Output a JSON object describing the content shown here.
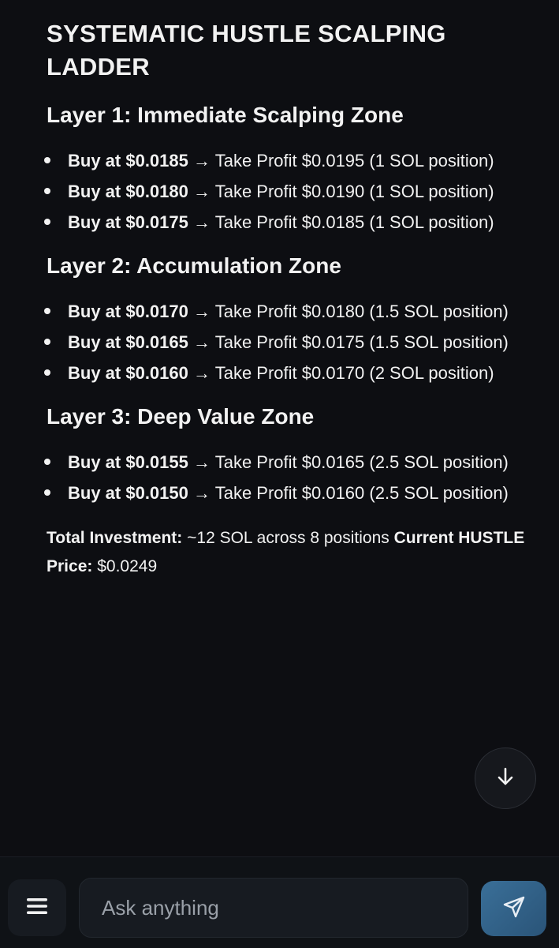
{
  "title": "SYSTEMATIC HUSTLE SCALPING LADDER",
  "layers": [
    {
      "heading": "Layer 1: Immediate Scalping Zone",
      "items": [
        {
          "buy": "Buy at $0.0185",
          "rest": " → Take Profit $0.0195 (1 SOL position)"
        },
        {
          "buy": "Buy at $0.0180",
          "rest": " → Take Profit $0.0190 (1 SOL position)"
        },
        {
          "buy": "Buy at $0.0175",
          "rest": " → Take Profit $0.0185 (1 SOL position)"
        }
      ]
    },
    {
      "heading": "Layer 2: Accumulation Zone",
      "items": [
        {
          "buy": "Buy at $0.0170",
          "rest": " → Take Profit $0.0180 (1.5 SOL position)"
        },
        {
          "buy": "Buy at $0.0165",
          "rest": " → Take Profit $0.0175 (1.5 SOL position)"
        },
        {
          "buy": "Buy at $0.0160",
          "rest": " → Take Profit $0.0170 (2 SOL position)"
        }
      ]
    },
    {
      "heading": "Layer 3: Deep Value Zone",
      "items": [
        {
          "buy": "Buy at $0.0155",
          "rest": " → Take Profit $0.0165 (2.5 SOL position)"
        },
        {
          "buy": "Buy at $0.0150",
          "rest": " → Take Profit $0.0160 (2.5 SOL position)"
        }
      ]
    }
  ],
  "summary": {
    "total_label": "Total Investment:",
    "total_value": " ~12 SOL across 8 positions ",
    "price_label": "Current HUSTLE Price:",
    "price_value": " $0.0249"
  },
  "composer": {
    "placeholder": "Ask anything"
  },
  "icons": {
    "menu": "menu-icon",
    "scroll_down": "arrow-down-icon",
    "send": "send-icon"
  },
  "colors": {
    "background": "#0d0e12",
    "send_button": "#336389"
  }
}
